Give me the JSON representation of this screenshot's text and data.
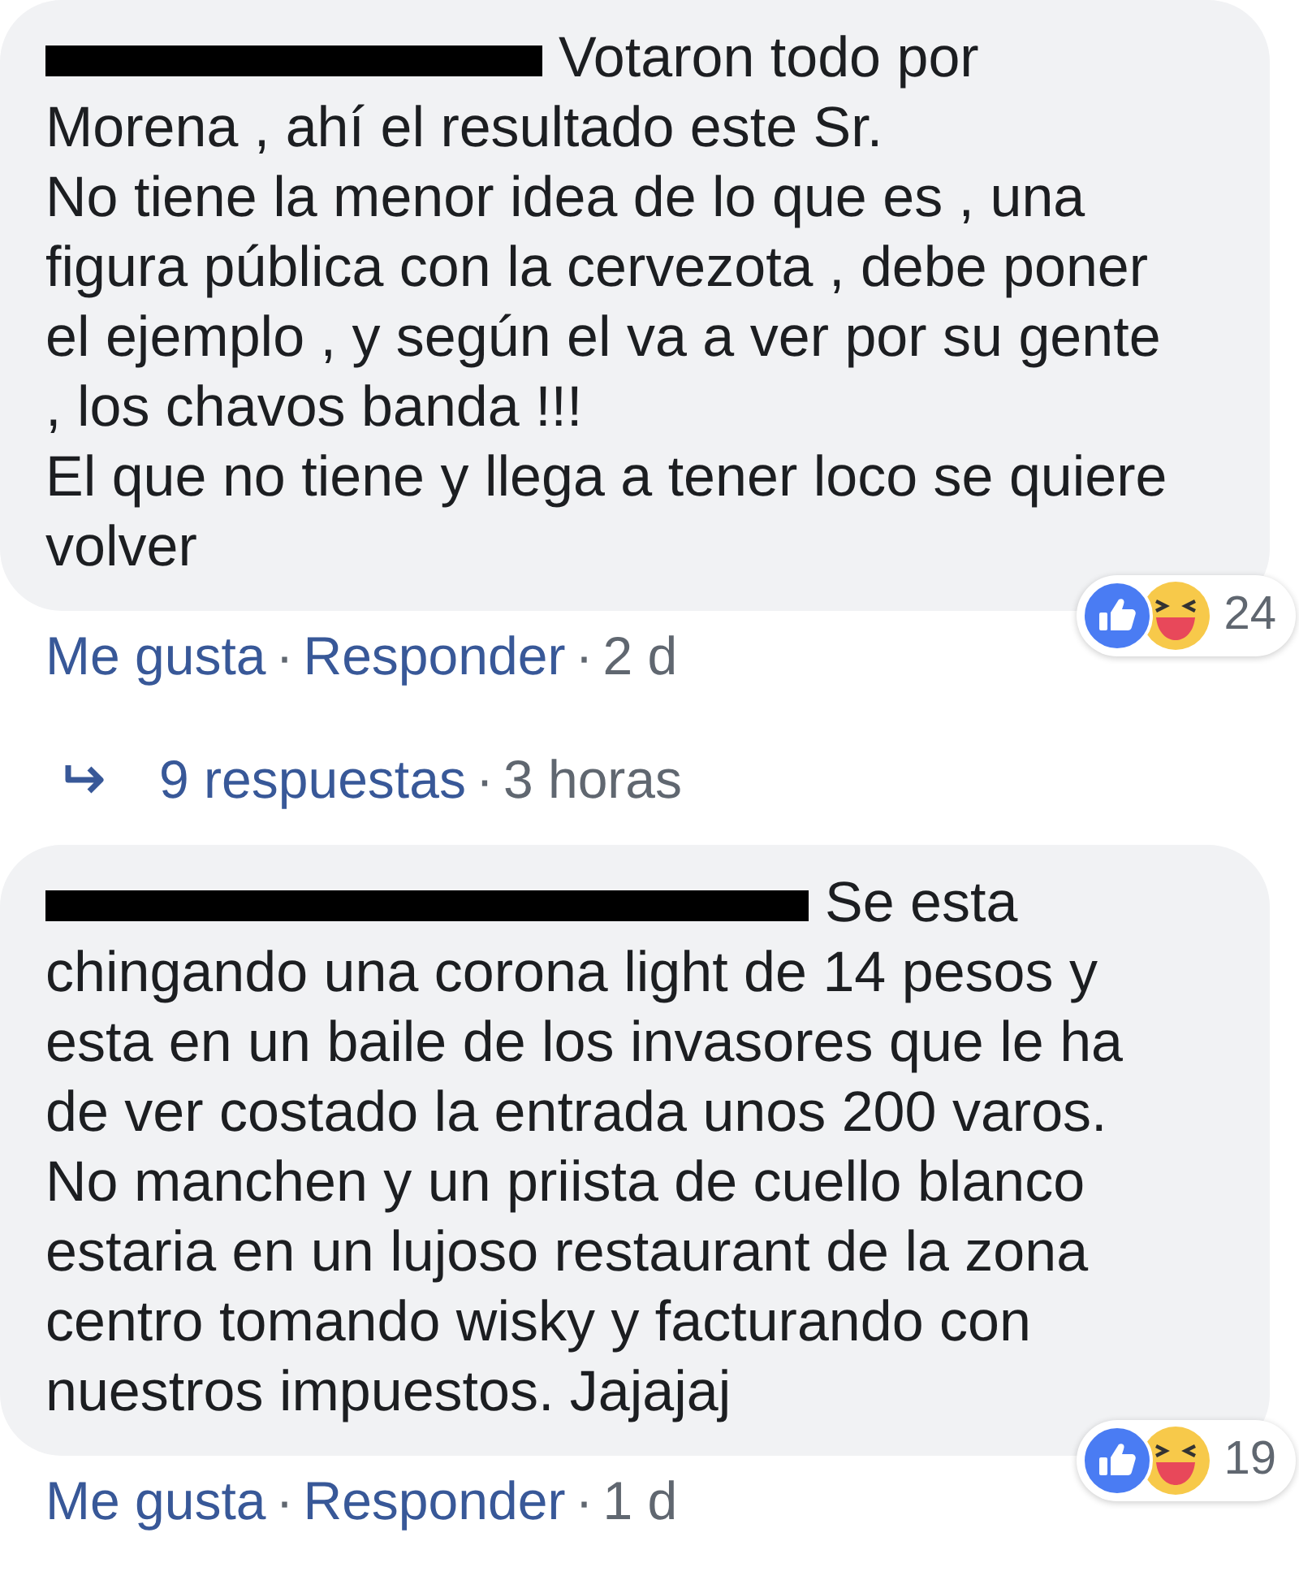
{
  "separator": "·",
  "comments": [
    {
      "name_redacted": true,
      "lead": "Votaron todo por",
      "text": "Morena , ahí el resultado este Sr.\nNo tiene la menor idea de lo que es , una\nfigura pública con la cervezota , debe poner\nel ejemplo , y según el va a ver por su gente\n, los chavos banda !!!\nEl que no tiene y llega a tener loco se quiere\nvolver",
      "reaction_count": "24",
      "actions": [
        {
          "kind": "link",
          "text": "Me gusta"
        },
        {
          "kind": "link",
          "text": "Responder"
        },
        {
          "kind": "time",
          "text": "2 d"
        }
      ],
      "replies": {
        "label": "9 respuestas",
        "time": "3 horas"
      }
    },
    {
      "name_redacted": true,
      "lead": "Se esta",
      "text": "chingando una corona light de 14 pesos y\nesta en un baile de los invasores que le ha\nde ver costado la entrada unos 200 varos.\nNo manchen y un priista de cuello blanco\nestaria en un lujoso restaurant de la zona\ncentro tomando wisky y facturando con\nnuestros impuestos. Jajajaj",
      "reaction_count": "19",
      "actions": [
        {
          "kind": "link",
          "text": "Me gusta"
        },
        {
          "kind": "link",
          "text": "Responder"
        },
        {
          "kind": "time",
          "text": "1 d"
        }
      ]
    }
  ]
}
